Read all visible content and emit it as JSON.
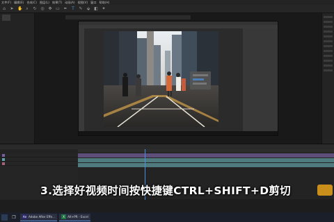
{
  "menubar": {
    "items": [
      "文件(F)",
      "编辑(E)",
      "合成(C)",
      "图层(L)",
      "效果(T)",
      "动画(A)",
      "视图(V)",
      "窗口",
      "帮助(H)"
    ]
  },
  "caption": {
    "text": "3.选择好视频时间按快捷键CTRL+SHIFT+D剪切"
  },
  "taskbar": {
    "apps": [
      {
        "label": "Adobe After Effe...",
        "icon": "after-effects-icon",
        "color": "#2c2a6e",
        "letter": "Ae"
      },
      {
        "label": "Alt+PR - Excel",
        "icon": "excel-icon",
        "color": "#1e7145",
        "letter": "X"
      }
    ]
  },
  "colors": {
    "accent": "#4a8fe0",
    "caption": "#ffffff",
    "watermark": "#e8a11a"
  },
  "timeline": {
    "layers": [
      {
        "swatch": "#7a5fa8"
      },
      {
        "swatch": "#5f9fa8"
      },
      {
        "swatch": "#a85f7a"
      }
    ]
  }
}
